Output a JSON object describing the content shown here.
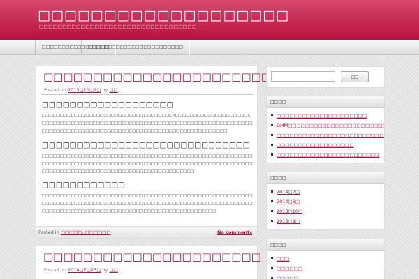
{
  "site": {
    "title": "□□□□□□□□□□□□□□□□□□□",
    "description": "□□□□□□□□□□□□□□□□□□□□□□□□□□□□□□□□□□"
  },
  "nav": {
    "items": [
      {
        "label": "□□□□□□□□□□□□□□□□□"
      },
      {
        "label": "□□□□□□□□□□□□□□□□□□□□□□□□"
      }
    ]
  },
  "posts": [
    {
      "title": "□□□□□□□□□□□□□□□□□□□□□□□□",
      "meta_prefix": "Posted on",
      "date": "2013□10□2□",
      "meta_by": "by",
      "author": "□□",
      "heading1": "□□□□□□□□□□□□□□□□□□□",
      "para1": "□□□□□□□□□□□□□□□□□□□□□□□□□□□□□□□□□□□□2□□□□□□□□□□□□□□□□□□□□□□□□□□□□□□□□□□□□□□□□□□□□□□□□□□□□□□□□□□□□□□□□□□□□□□□□□□□□□□□□□□□□□□□□□□□□□□□□□□□□□□□□□□□□□□□□□□□□□□□□□□□□□□□□□□",
      "heading2": "□□□□□□□□□□□□□□□□□□□□□□□□□□□□□□",
      "para2": "□□□□□□□□□□□□□□□□□□□□□□□□□□□□□□□□□□□□□□□□□□□□□□□□□□□□□□□□□□□□□□□□□□□□□□□□□□□□□□□□□□□□□□□□□□□□□□□□□□□□□□□□□□□□□□□□□□□□□□□□□□□□□□□□□□□□□□□□□□□□□□□□□□□□□□□□□□□□□□",
      "heading3": "□□□□□□□□□□□□",
      "para3": "□□□□□□□□□□□□□□□□□□□□□□□□□□□□□□□□□□□□□□□□□□□□□□□□□□□□□□□□□□□□□□□□□□□□□□□□□□□□□□□□□□□□□□□□□□□□□□□□□□□□□□□□□□□□□□□□□□□□□□□□□□□□□□□□□□□□□□□□□□□□□□□□□□□□□□□□□□□□□□□□□□□□",
      "footer_prefix": "Posted in",
      "categories": "□□□□□, □□□□□□",
      "comments": "No comments"
    },
    {
      "title": "□□□□□□□□□□□□□□□□□□□□□□",
      "meta_prefix": "Posted on",
      "date": "2014□7□23□",
      "meta_by": "by",
      "author": "□□"
    }
  ],
  "search": {
    "placeholder": "",
    "button_label": "□□"
  },
  "widgets": [
    {
      "title": "□□□□",
      "items": [
        "□□□□□□□□□□□□□□□□□□□□□",
        "DMM□□□□□□□□□□□□□□□□□□□□□□□□",
        "□□□□□□□□□□□□□□□□□□□□□□□□□□",
        "□□□□□□□□□□□□□□□□□□",
        "□□□□□□□□□□□□□□□□□□□□□□□□"
      ]
    },
    {
      "title": "□□□□",
      "items": [
        "2014□7□",
        "2014□6□",
        "2013□10□",
        "2013□9□"
      ]
    },
    {
      "title": "□□□□",
      "items": [
        "□□□",
        "□□□□□□",
        "□□□□□"
      ]
    }
  ],
  "colors": {
    "accent": "#b8113e",
    "header_top": "#d6486f"
  }
}
